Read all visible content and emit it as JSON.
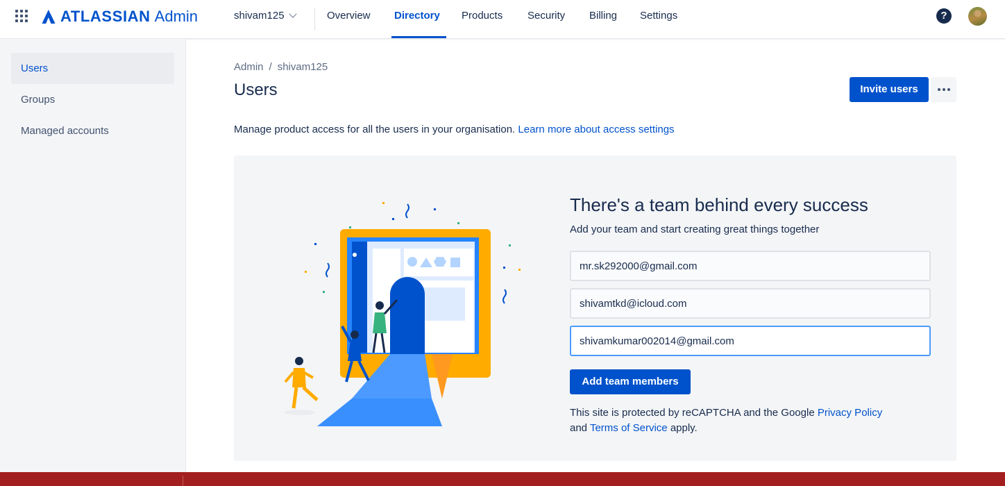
{
  "header": {
    "brand": "ATLASSIAN",
    "product": "Admin",
    "org": "shivam125",
    "nav": [
      "Overview",
      "Directory",
      "Products",
      "Security",
      "Billing",
      "Settings"
    ],
    "active_tab": "Directory",
    "help_glyph": "?"
  },
  "sidebar": {
    "items": [
      {
        "label": "Users",
        "active": true
      },
      {
        "label": "Groups",
        "active": false
      },
      {
        "label": "Managed accounts",
        "active": false
      }
    ]
  },
  "main": {
    "breadcrumb": [
      "Admin",
      "shivam125"
    ],
    "breadcrumb_sep": "/",
    "title": "Users",
    "invite_label": "Invite users",
    "description": "Manage product access for all the users in your organisation.",
    "learn_more": "Learn more about access settings"
  },
  "panel": {
    "title": "There's a team behind every success",
    "subtitle": "Add your team and start creating great things together",
    "emails": [
      "mr.sk292000@gmail.com",
      "shivamtkd@icloud.com",
      "shivamkumar002014@gmail.com"
    ],
    "add_label": "Add team members",
    "legal_prefix": "This site is protected by reCAPTCHA and the Google",
    "privacy": "Privacy Policy",
    "legal_and": "and",
    "terms": "Terms of Service",
    "legal_suffix": "apply."
  },
  "icons": {
    "app_switcher": "grid-icon",
    "more": "more-horizontal-icon",
    "help": "help-icon"
  },
  "colors": {
    "brand": "#0052CC",
    "footer": "#A31F1F",
    "sidebar_bg": "#F4F5F7"
  }
}
